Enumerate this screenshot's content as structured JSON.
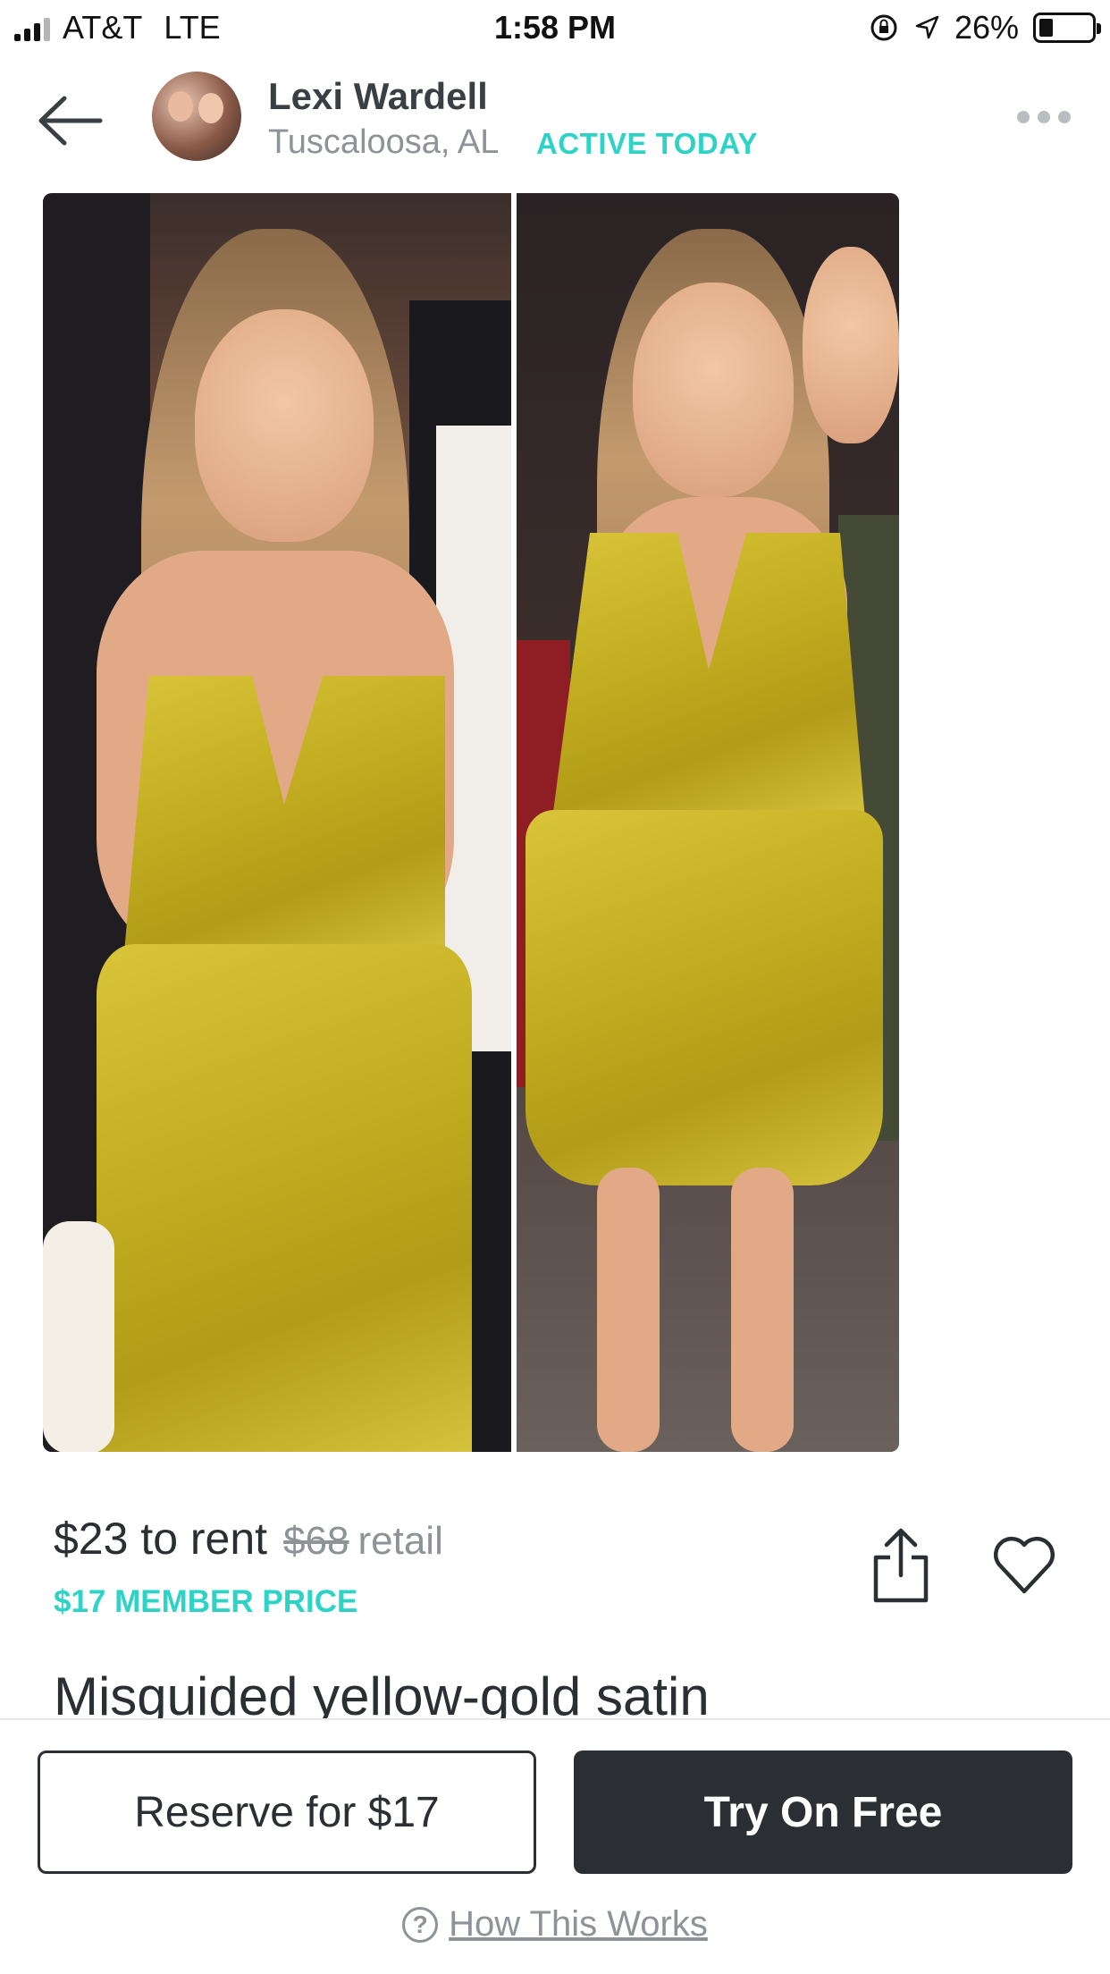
{
  "status_bar": {
    "carrier": "AT&T",
    "network": "LTE",
    "time": "1:58 PM",
    "battery": "26%"
  },
  "header": {
    "seller_name": "Lexi Wardell",
    "location": "Tuscaloosa, AL",
    "activity": "ACTIVE TODAY"
  },
  "listing": {
    "rent_price": "$23 to rent",
    "retail_price": "$68",
    "retail_label": "retail",
    "member_price": "$17 MEMBER PRICE",
    "title": "Misguided yellow-gold satin"
  },
  "actions": {
    "reserve_label": "Reserve for $17",
    "try_label": "Try On Free",
    "how_label": "How This Works",
    "how_icon": "?"
  },
  "colors": {
    "accent": "#2ed3c6",
    "dark": "#2b2f33",
    "muted": "#8e9398",
    "dress": "#c9b22a"
  }
}
